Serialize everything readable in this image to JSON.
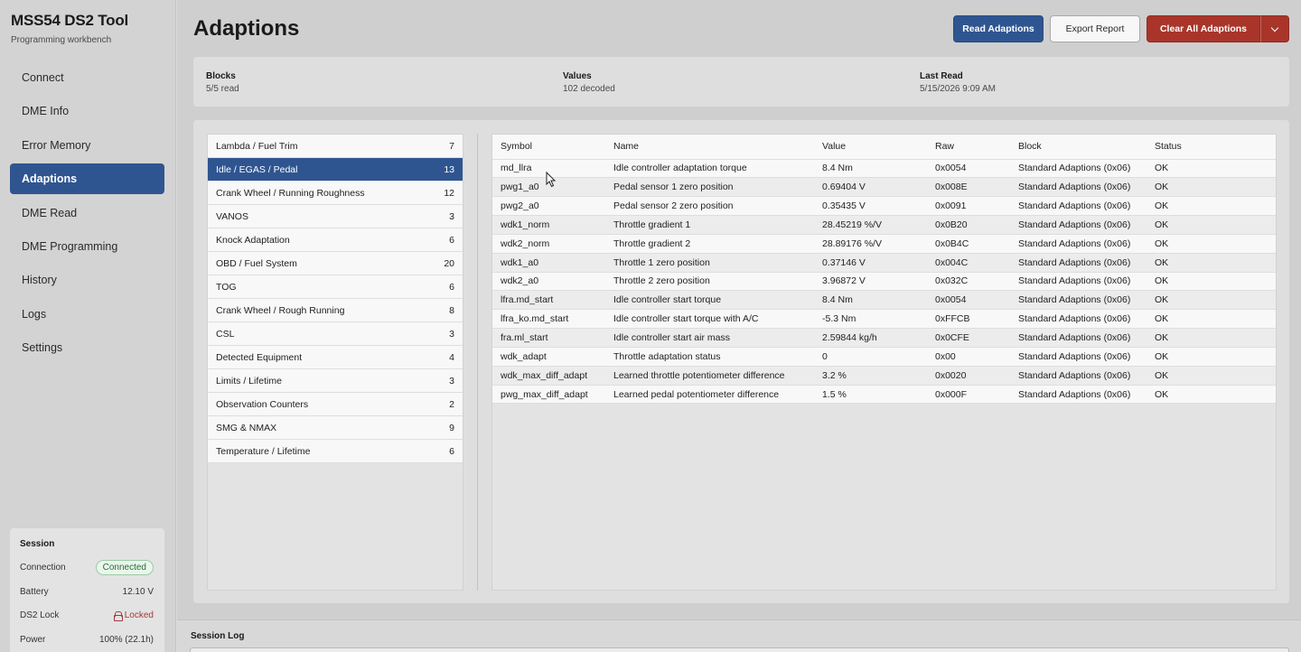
{
  "app": {
    "title": "MSS54 DS2 Tool",
    "subtitle": "Programming workbench"
  },
  "nav": [
    {
      "label": "Connect",
      "active": false
    },
    {
      "label": "DME Info",
      "active": false
    },
    {
      "label": "Error Memory",
      "active": false
    },
    {
      "label": "Adaptions",
      "active": true
    },
    {
      "label": "DME Read",
      "active": false
    },
    {
      "label": "DME Programming",
      "active": false
    },
    {
      "label": "History",
      "active": false
    },
    {
      "label": "Logs",
      "active": false
    },
    {
      "label": "Settings",
      "active": false
    }
  ],
  "session": {
    "title": "Session",
    "connection_label": "Connection",
    "connection_value": "Connected",
    "battery_label": "Battery",
    "battery_value": "12.10 V",
    "lock_label": "DS2 Lock",
    "lock_value": "Locked",
    "power_label": "Power",
    "power_value": "100% (22.1h)"
  },
  "page": {
    "title": "Adaptions"
  },
  "toolbar": {
    "read_label": "Read Adaptions",
    "export_label": "Export Report",
    "clear_label": "Clear All Adaptions"
  },
  "summary": {
    "blocks_label": "Blocks",
    "blocks_value": "5/5 read",
    "values_label": "Values",
    "values_value": "102 decoded",
    "lastread_label": "Last Read",
    "lastread_value": "5/15/2026 9:09 AM"
  },
  "blocks": [
    {
      "name": "Lambda / Fuel Trim",
      "count": "7"
    },
    {
      "name": "Idle / EGAS / Pedal",
      "count": "13",
      "active": true
    },
    {
      "name": "Crank Wheel / Running Roughness",
      "count": "12"
    },
    {
      "name": "VANOS",
      "count": "3"
    },
    {
      "name": "Knock Adaptation",
      "count": "6"
    },
    {
      "name": "OBD / Fuel System",
      "count": "20"
    },
    {
      "name": "TOG",
      "count": "6"
    },
    {
      "name": "Crank Wheel / Rough Running",
      "count": "8"
    },
    {
      "name": "CSL",
      "count": "3"
    },
    {
      "name": "Detected Equipment",
      "count": "4"
    },
    {
      "name": "Limits / Lifetime",
      "count": "3"
    },
    {
      "name": "Observation Counters",
      "count": "2"
    },
    {
      "name": "SMG & NMAX",
      "count": "9"
    },
    {
      "name": "Temperature / Lifetime",
      "count": "6"
    }
  ],
  "table": {
    "headers": [
      "Symbol",
      "Name",
      "Value",
      "Raw",
      "Block",
      "Status"
    ],
    "rows": [
      [
        "md_llra",
        "Idle controller adaptation torque",
        "8.4 Nm",
        "0x0054",
        "Standard Adaptions (0x06)",
        "OK"
      ],
      [
        "pwg1_a0",
        "Pedal sensor 1 zero position",
        "0.69404 V",
        "0x008E",
        "Standard Adaptions (0x06)",
        "OK"
      ],
      [
        "pwg2_a0",
        "Pedal sensor 2 zero position",
        "0.35435 V",
        "0x0091",
        "Standard Adaptions (0x06)",
        "OK"
      ],
      [
        "wdk1_norm",
        "Throttle gradient 1",
        "28.45219 %/V",
        "0x0B20",
        "Standard Adaptions (0x06)",
        "OK"
      ],
      [
        "wdk2_norm",
        "Throttle gradient 2",
        "28.89176 %/V",
        "0x0B4C",
        "Standard Adaptions (0x06)",
        "OK"
      ],
      [
        "wdk1_a0",
        "Throttle 1 zero position",
        "0.37146 V",
        "0x004C",
        "Standard Adaptions (0x06)",
        "OK"
      ],
      [
        "wdk2_a0",
        "Throttle 2 zero position",
        "3.96872 V",
        "0x032C",
        "Standard Adaptions (0x06)",
        "OK"
      ],
      [
        "lfra.md_start",
        "Idle controller start torque",
        "8.4 Nm",
        "0x0054",
        "Standard Adaptions (0x06)",
        "OK"
      ],
      [
        "lfra_ko.md_start",
        "Idle controller start torque with A/C",
        "-5.3 Nm",
        "0xFFCB",
        "Standard Adaptions (0x06)",
        "OK"
      ],
      [
        "fra.ml_start",
        "Idle controller start air mass",
        "2.59844 kg/h",
        "0x0CFE",
        "Standard Adaptions (0x06)",
        "OK"
      ],
      [
        "wdk_adapt",
        "Throttle adaptation status",
        "0",
        "0x00",
        "Standard Adaptions (0x06)",
        "OK"
      ],
      [
        "wdk_max_diff_adapt",
        "Learned throttle potentiometer difference",
        "3.2 %",
        "0x0020",
        "Standard Adaptions (0x06)",
        "OK"
      ],
      [
        "pwg_max_diff_adapt",
        "Learned pedal potentiometer difference",
        "1.5 %",
        "0x000F",
        "Standard Adaptions (0x06)",
        "OK"
      ]
    ]
  },
  "log": {
    "title": "Session Log"
  },
  "icons": {
    "dropdown": "chevron-down-icon",
    "lock": "lock-icon",
    "cursor": "mouse-pointer-icon"
  },
  "colors": {
    "accent": "#2f5591",
    "danger": "#a9352a",
    "success": "#2a6b37"
  }
}
